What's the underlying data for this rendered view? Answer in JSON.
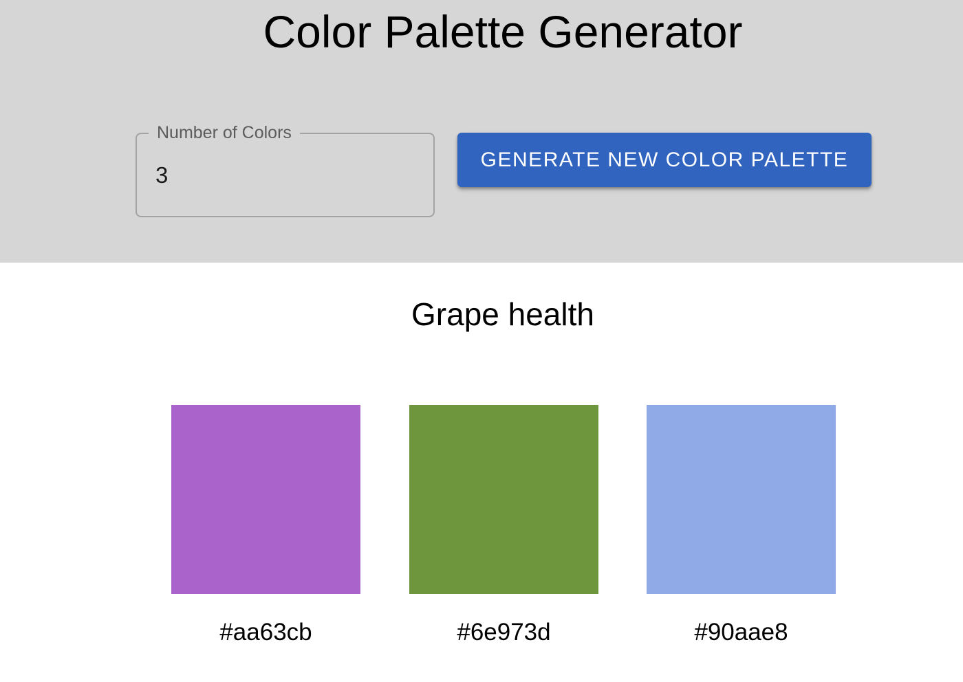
{
  "header": {
    "title": "Color Palette Generator",
    "background": "#d6d6d6"
  },
  "controls": {
    "number_of_colors": {
      "label": "Number of Colors",
      "value": "3"
    },
    "generate_button": {
      "label": "GENERATE NEW COLOR PALETTE",
      "color": "#3064bf"
    }
  },
  "palette": {
    "name": "Grape health",
    "colors": [
      {
        "hex": "#aa63cb",
        "label": "#aa63cb"
      },
      {
        "hex": "#6e973d",
        "label": "#6e973d"
      },
      {
        "hex": "#90aae8",
        "label": "#90aae8"
      }
    ]
  }
}
